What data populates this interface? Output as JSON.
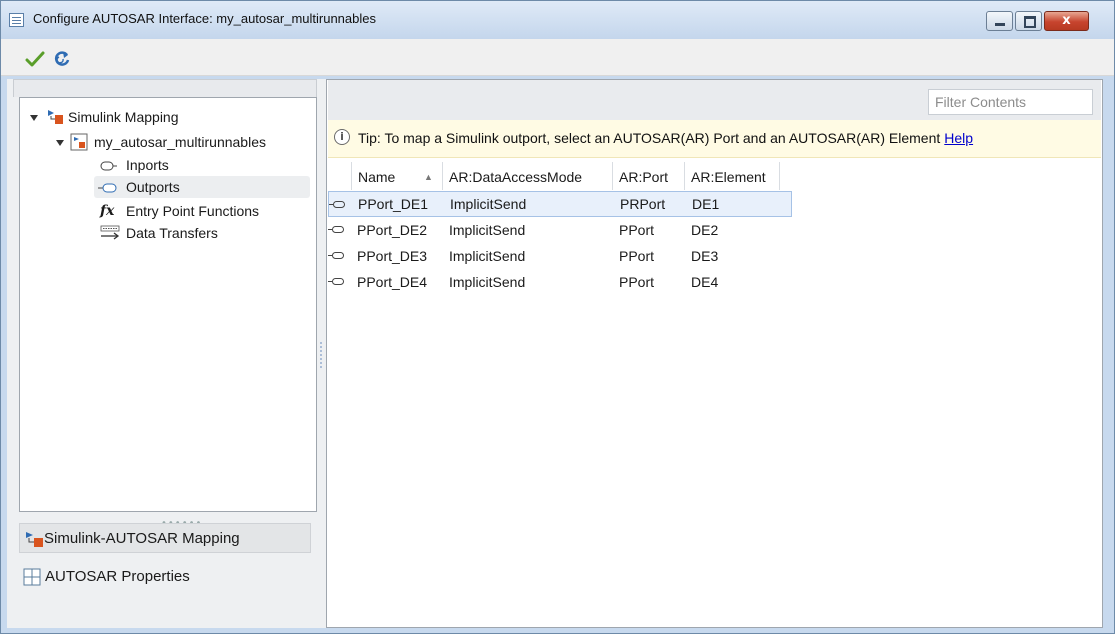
{
  "window": {
    "title": "Configure AUTOSAR Interface: my_autosar_multirunnables",
    "close_label": "x"
  },
  "toolbar": {
    "icons": [
      "apply-checkmark-icon",
      "refresh-icon"
    ]
  },
  "tree": {
    "root": "Simulink Mapping",
    "model": "my_autosar_multirunnables",
    "items": [
      {
        "label": "Inports",
        "icon": "inport-icon",
        "selected": false
      },
      {
        "label": "Outports",
        "icon": "outport-icon",
        "selected": true
      },
      {
        "label": "Entry Point Functions",
        "icon": "fx-icon",
        "selected": false
      },
      {
        "label": "Data Transfers",
        "icon": "data-transfer-icon",
        "selected": false
      }
    ]
  },
  "sections": {
    "mapping": "Simulink-AUTOSAR Mapping",
    "properties": "AUTOSAR Properties"
  },
  "filter": {
    "placeholder": "Filter Contents"
  },
  "tip": {
    "text": "Tip: To map a Simulink outport, select an AUTOSAR(AR) Port and an AUTOSAR(AR) Element",
    "help": "Help"
  },
  "table": {
    "columns": [
      "Name",
      "AR:DataAccessMode",
      "AR:Port",
      "AR:Element"
    ],
    "rows": [
      [
        "PPort_DE1",
        "ImplicitSend",
        "PRPort",
        "DE1"
      ],
      [
        "PPort_DE2",
        "ImplicitSend",
        "PPort",
        "DE2"
      ],
      [
        "PPort_DE3",
        "ImplicitSend",
        "PPort",
        "DE3"
      ],
      [
        "PPort_DE4",
        "ImplicitSend",
        "PPort",
        "DE4"
      ]
    ],
    "selected_row": 0
  },
  "colors": {
    "titlebar": "#c4d6ec",
    "close_button": "#c7442e",
    "tip_background": "#fffbe4",
    "selection": "#e8f0fb",
    "link": "#0000cc"
  }
}
